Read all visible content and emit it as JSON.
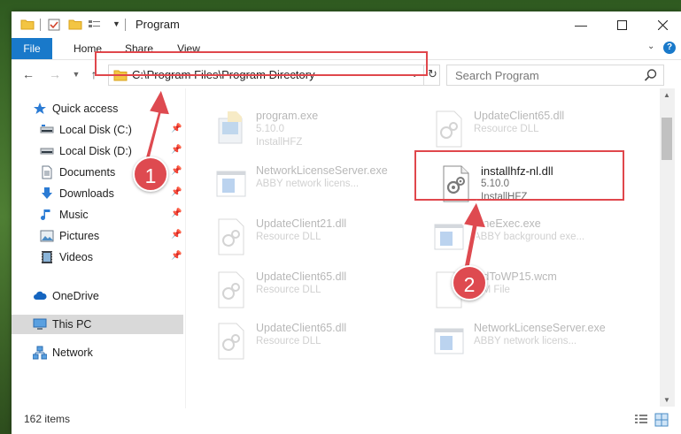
{
  "window": {
    "title": "Program"
  },
  "ribbon": {
    "tabs": [
      "File",
      "Home",
      "Share",
      "View"
    ]
  },
  "address": {
    "path": "C:\\Program Files\\Program Directory"
  },
  "search": {
    "placeholder": "Search Program"
  },
  "sidebar": {
    "items": [
      {
        "label": "Quick access",
        "icon": "star-icon"
      },
      {
        "label": "Local Disk (C:)",
        "icon": "drive-icon",
        "pinned": true
      },
      {
        "label": "Local Disk (D:)",
        "icon": "drive-icon",
        "pinned": true
      },
      {
        "label": "Documents",
        "icon": "documents-icon",
        "pinned": true
      },
      {
        "label": "Downloads",
        "icon": "downloads-icon",
        "pinned": true
      },
      {
        "label": "Music",
        "icon": "music-icon",
        "pinned": true
      },
      {
        "label": "Pictures",
        "icon": "pictures-icon",
        "pinned": true
      },
      {
        "label": "Videos",
        "icon": "videos-icon",
        "pinned": true
      },
      {
        "label": "OneDrive",
        "icon": "cloud-icon"
      },
      {
        "label": "This PC",
        "icon": "computer-icon",
        "selected": true
      },
      {
        "label": "Network",
        "icon": "network-icon"
      }
    ]
  },
  "files": [
    {
      "name": "program.exe",
      "line2": "5.10.0",
      "line3": "InstallHFZ",
      "kind": "exe"
    },
    {
      "name": "UpdateClient65.dll",
      "line2": "Resource DLL",
      "line3": "",
      "kind": "dll"
    },
    {
      "name": "NetworkLicenseServer.exe",
      "line2": "ABBY network licens...",
      "line3": "",
      "kind": "app"
    },
    {
      "name": "installhfz-nl.dll",
      "line2": "5.10.0",
      "line3": "InstallHFZ",
      "kind": "dll"
    },
    {
      "name": "UpdateClient21.dll",
      "line2": "Resource DLL",
      "line3": "",
      "kind": "dll"
    },
    {
      "name": "...neExec.exe",
      "line2": "ABBY background exe...",
      "line3": "",
      "kind": "app"
    },
    {
      "name": "UpdateClient65.dll",
      "line2": "Resource DLL",
      "line3": "",
      "kind": "dll"
    },
    {
      "name": "...dToWP15.wcm",
      "line2": "...M File",
      "line3": "",
      "kind": "dll"
    },
    {
      "name": "UpdateClient65.dll",
      "line2": "Resource DLL",
      "line3": "",
      "kind": "dll"
    },
    {
      "name": "NetworkLicenseServer.exe",
      "line2": "ABBY network licens...",
      "line3": "",
      "kind": "app"
    }
  ],
  "status": {
    "items_count": "162 items"
  },
  "callouts": {
    "one": "1",
    "two": "2"
  },
  "colors": {
    "accent": "#1979ca",
    "callout": "#de4a50",
    "selection": "#d9d9d9"
  }
}
